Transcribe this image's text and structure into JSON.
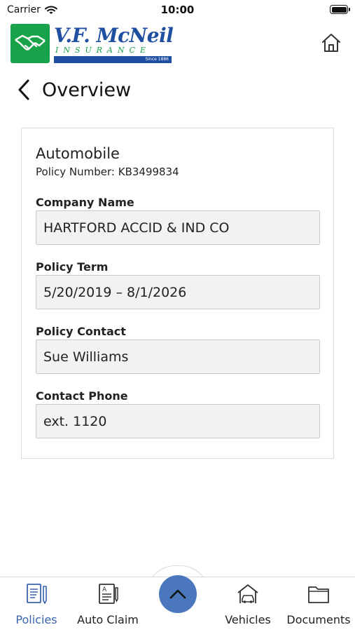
{
  "status_bar": {
    "carrier": "Carrier",
    "time": "10:00"
  },
  "header": {
    "logo": {
      "name": "V.F. McNeil",
      "tagline": "INSURANCE",
      "since": "Since 1886"
    }
  },
  "nav": {
    "title": "Overview"
  },
  "card": {
    "title": "Automobile",
    "policy_number": "Policy Number: KB3499834",
    "fields": [
      {
        "label": "Company Name",
        "value": "HARTFORD ACCID & IND CO"
      },
      {
        "label": "Policy Term",
        "value": "5/20/2019 – 8/1/2026"
      },
      {
        "label": "Policy Contact",
        "value": "Sue Williams"
      },
      {
        "label": "Contact Phone",
        "value": "ext. 1120"
      }
    ]
  },
  "tab_bar": {
    "tabs": [
      {
        "label": "Policies",
        "icon": "policies-icon",
        "active": true
      },
      {
        "label": "Auto Claim",
        "icon": "auto-claim-icon",
        "active": false
      },
      {
        "label": "Vehicles",
        "icon": "vehicles-icon",
        "active": false
      },
      {
        "label": "Documents",
        "icon": "documents-icon",
        "active": false
      }
    ],
    "center_button_icon": "chevron-up-icon"
  },
  "colors": {
    "brand_blue": "#1f4fa0",
    "brand_green": "#18a34a",
    "accent": "#4b78bd",
    "active_tab": "#3a63ad"
  }
}
